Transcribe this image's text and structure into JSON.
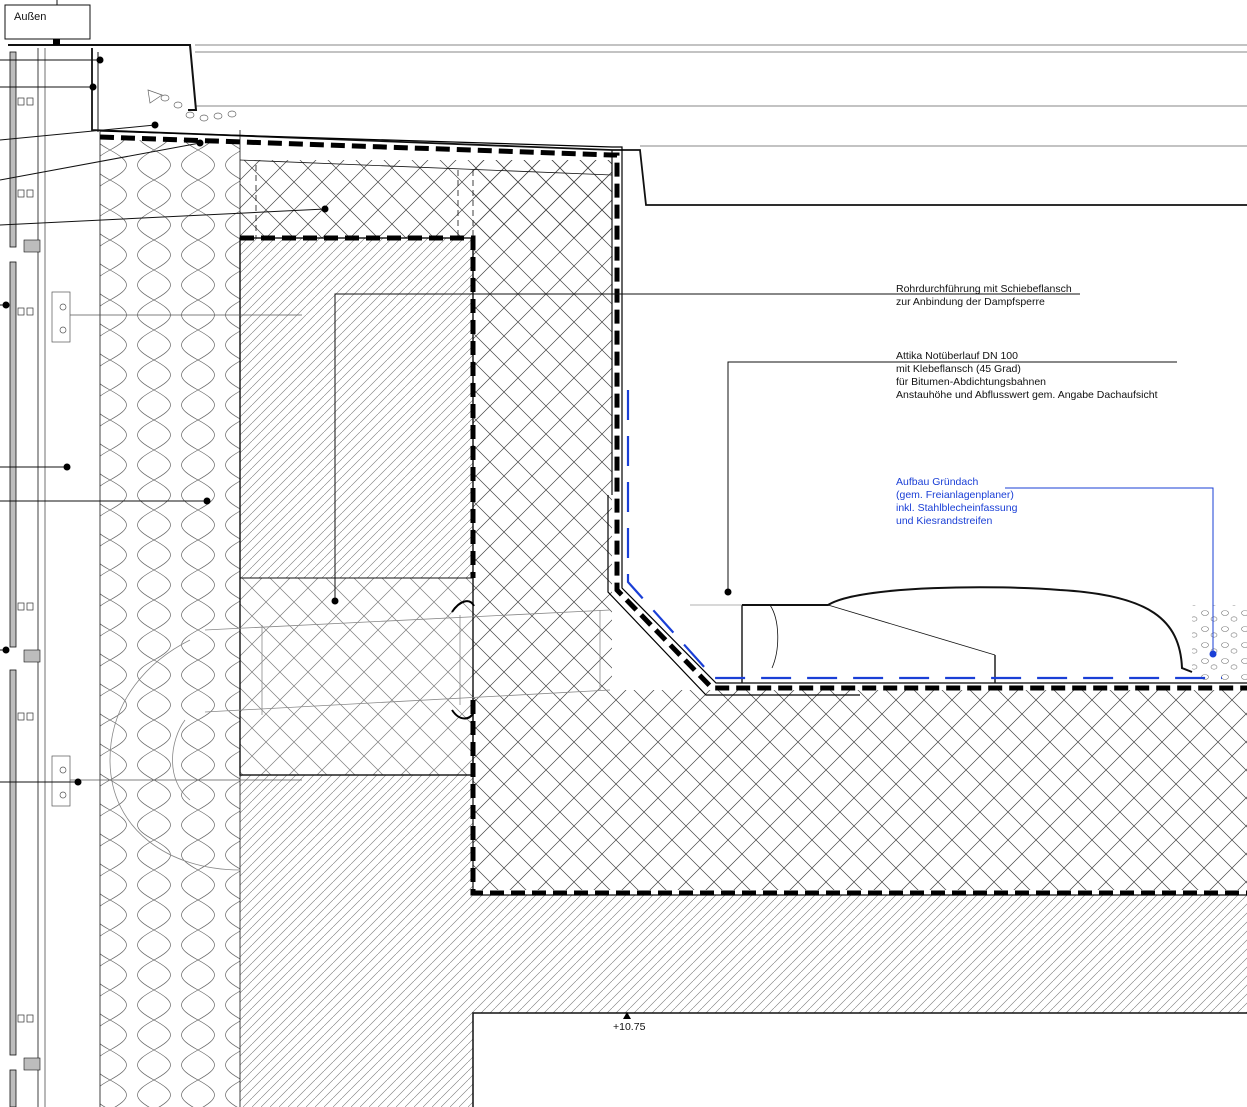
{
  "room_tag": {
    "text": "Außen"
  },
  "callouts": {
    "pipe_penetration": {
      "line1": "Rohrdurchführung mit Schiebeflansch",
      "line2": "zur Anbindung der Dampfsperre"
    },
    "overflow": {
      "line1": "Attika Notüberlauf DN 100",
      "line2": "mit Klebeflansch (45 Grad)",
      "line3": "für Bitumen-Abdichtungsbahnen",
      "line4": "Anstauhöhe und Abflusswert gem. Angabe Dachaufsicht"
    },
    "green_roof": {
      "line1": "Aufbau Gründach",
      "line2": "(gem. Freianlagenplaner)",
      "line3": "inkl. Stahlblecheinfassung",
      "line4": "und Kiesrandstreifen"
    }
  },
  "level_marker": {
    "text": "+10.75"
  },
  "colors": {
    "line": "#111111",
    "annotation_blue": "#1a3fd6",
    "cladding_grey": "#bdbdbd",
    "hatch": "#555555"
  }
}
